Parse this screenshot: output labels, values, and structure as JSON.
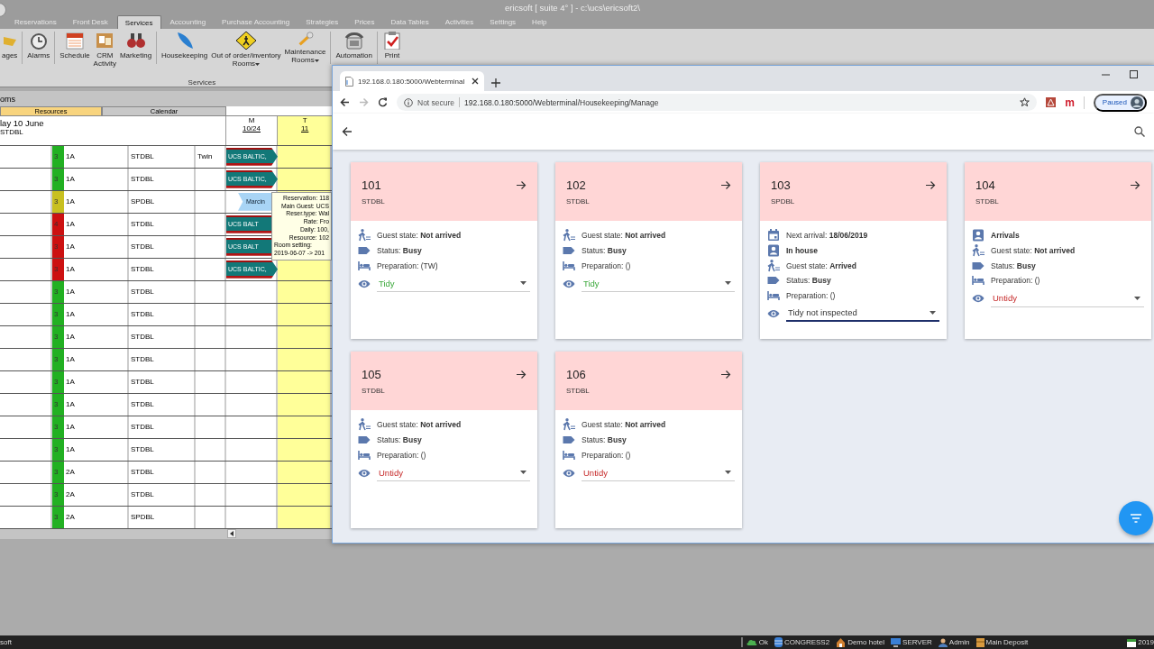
{
  "window": {
    "title": "ericsoft [ suite 4° ] - c:\\ucs\\ericsoft2\\"
  },
  "ribbon": {
    "tabs": [
      {
        "label": "Reservations",
        "selected": false
      },
      {
        "label": "Front Desk",
        "selected": false
      },
      {
        "label": "Services",
        "selected": true
      },
      {
        "label": "Accounting",
        "selected": false
      },
      {
        "label": "Purchase Accounting",
        "selected": false
      },
      {
        "label": "Strategies",
        "selected": false
      },
      {
        "label": "Prices",
        "selected": false
      },
      {
        "label": "Data Tables",
        "selected": false
      },
      {
        "label": "Activities",
        "selected": false
      },
      {
        "label": "Settings",
        "selected": false
      },
      {
        "label": "Help",
        "selected": false
      }
    ],
    "buttons": [
      {
        "lines": [
          "ages"
        ],
        "dropdown": false,
        "separator_after": true
      },
      {
        "lines": [
          "Alarms"
        ],
        "dropdown": false,
        "separator_after": true
      },
      {
        "lines": [
          "Schedule"
        ],
        "dropdown": false,
        "separator_after": false
      },
      {
        "lines": [
          "CRM",
          "Activity"
        ],
        "dropdown": false,
        "separator_after": false
      },
      {
        "lines": [
          "Marketing"
        ],
        "dropdown": false,
        "separator_after": true
      },
      {
        "lines": [
          "Housekeeping"
        ],
        "dropdown": false,
        "separator_after": false
      },
      {
        "lines": [
          "Out of order/inventory",
          "Rooms"
        ],
        "dropdown": true,
        "separator_after": false
      },
      {
        "lines": [
          "Maintenance",
          "Rooms"
        ],
        "dropdown": true,
        "separator_after": true
      },
      {
        "lines": [
          "Automation"
        ],
        "dropdown": false,
        "separator_after": true
      },
      {
        "lines": [
          "Print"
        ],
        "dropdown": false,
        "separator_after": false
      }
    ],
    "group_label": "Services"
  },
  "planner": {
    "title": "oms",
    "view_tabs": [
      {
        "label": "Resources",
        "selected": true
      },
      {
        "label": "Calendar",
        "selected": false
      }
    ],
    "header": {
      "date": "lay 10 June",
      "type": "STDBL"
    },
    "days": [
      {
        "weekday": "M",
        "date": "10/24",
        "highlight": false
      },
      {
        "weekday": "T",
        "date": "11",
        "highlight": true
      }
    ],
    "rows": [
      {
        "status": "3",
        "color": "#22b022",
        "floor": "1A",
        "type": "STDBL",
        "note": "Twin",
        "booking": {
          "text": "UCS BALTIC,",
          "kind": "group"
        }
      },
      {
        "status": "3",
        "color": "#22b022",
        "floor": "1A",
        "type": "STDBL",
        "booking": {
          "text": "UCS BALTIC,",
          "kind": "group"
        }
      },
      {
        "status": "3",
        "color": "#c8c020",
        "floor": "1A",
        "type": "SPDBL",
        "booking": {
          "text": "Marcin",
          "kind": "guest"
        }
      },
      {
        "status": "4",
        "color": "#cc1111",
        "floor": "1A",
        "type": "STDBL",
        "booking": {
          "text": "UCS BALT",
          "kind": "group"
        }
      },
      {
        "status": "3",
        "color": "#cc1111",
        "floor": "1A",
        "type": "STDBL",
        "booking": {
          "text": "UCS BALT",
          "kind": "group"
        }
      },
      {
        "status": "3",
        "color": "#cc1111",
        "floor": "1A",
        "type": "STDBL",
        "booking": {
          "text": "UCS BALTIC,",
          "kind": "group"
        }
      },
      {
        "status": "3",
        "color": "#22b022",
        "floor": "1A",
        "type": "STDBL"
      },
      {
        "status": "3",
        "color": "#22b022",
        "floor": "1A",
        "type": "STDBL"
      },
      {
        "status": "3",
        "color": "#22b022",
        "floor": "1A",
        "type": "STDBL"
      },
      {
        "status": "3",
        "color": "#22b022",
        "floor": "1A",
        "type": "STDBL"
      },
      {
        "status": "3",
        "color": "#22b022",
        "floor": "1A",
        "type": "STDBL"
      },
      {
        "status": "3",
        "color": "#22b022",
        "floor": "1A",
        "type": "STDBL"
      },
      {
        "status": "3",
        "color": "#22b022",
        "floor": "1A",
        "type": "STDBL"
      },
      {
        "status": "3",
        "color": "#22b022",
        "floor": "1A",
        "type": "STDBL"
      },
      {
        "status": "3",
        "color": "#22b022",
        "floor": "2A",
        "type": "STDBL"
      },
      {
        "status": "3",
        "color": "#22b022",
        "floor": "2A",
        "type": "STDBL"
      },
      {
        "status": "3",
        "color": "#22b022",
        "floor": "2A",
        "type": "SPDBL"
      }
    ],
    "tooltip": [
      "Reservation: 118",
      "Main Guest: UCS",
      "Reser.type: Wal",
      "Rate: Fro",
      "Daily: 100,",
      "Resource: 102",
      "Room setting:",
      "2019-06-07 -> 201"
    ]
  },
  "browser": {
    "tab_title": "192.168.0.180:5000/Webterminal",
    "security": "Not secure",
    "url": "192.168.0.180:5000/Webterminal/Housekeeping/Manage",
    "extension_letter": "m",
    "profile": "Paused"
  },
  "rooms": [
    {
      "number": "101",
      "type": "STDBL",
      "lines": [
        {
          "kind": "guest_state",
          "label": "Guest state:",
          "value": "Not arrived"
        },
        {
          "kind": "status",
          "label": "Status:",
          "value": "Busy"
        },
        {
          "kind": "preparation",
          "label": "Preparation: (TW)"
        }
      ],
      "cleaning": {
        "value": "Tidy",
        "clean": true,
        "inspected": true,
        "focused": false
      }
    },
    {
      "number": "102",
      "type": "STDBL",
      "lines": [
        {
          "kind": "guest_state",
          "label": "Guest state:",
          "value": "Not arrived"
        },
        {
          "kind": "status",
          "label": "Status:",
          "value": "Busy"
        },
        {
          "kind": "preparation",
          "label": "Preparation: ()"
        }
      ],
      "cleaning": {
        "value": "Tidy",
        "clean": true,
        "inspected": true,
        "focused": false
      }
    },
    {
      "number": "103",
      "type": "SPDBL",
      "lines": [
        {
          "kind": "next_arrival",
          "label": "Next arrival:",
          "value": "18/06/2019"
        },
        {
          "kind": "in_house",
          "value": "In house"
        },
        {
          "kind": "guest_state",
          "label": "Guest state:",
          "value": "Arrived"
        },
        {
          "kind": "status",
          "label": "Status:",
          "value": "Busy"
        },
        {
          "kind": "preparation",
          "label": "Preparation: ()"
        }
      ],
      "cleaning": {
        "value": "Tidy not inspected",
        "clean": true,
        "inspected": false,
        "focused": true
      }
    },
    {
      "number": "104",
      "type": "STDBL",
      "lines": [
        {
          "kind": "arrivals",
          "value": "Arrivals"
        },
        {
          "kind": "guest_state",
          "label": "Guest state:",
          "value": "Not arrived"
        },
        {
          "kind": "status",
          "label": "Status:",
          "value": "Busy"
        },
        {
          "kind": "preparation",
          "label": "Preparation: ()"
        }
      ],
      "cleaning": {
        "value": "Untidy",
        "clean": false,
        "inspected": true,
        "focused": false
      }
    },
    {
      "number": "105",
      "type": "STDBL",
      "lines": [
        {
          "kind": "guest_state",
          "label": "Guest state:",
          "value": "Not arrived"
        },
        {
          "kind": "status",
          "label": "Status:",
          "value": "Busy"
        },
        {
          "kind": "preparation",
          "label": "Preparation: ()"
        }
      ],
      "cleaning": {
        "value": "Untidy",
        "clean": false,
        "inspected": true,
        "focused": false
      }
    },
    {
      "number": "106",
      "type": "STDBL",
      "lines": [
        {
          "kind": "guest_state",
          "label": "Guest state:",
          "value": "Not arrived"
        },
        {
          "kind": "status",
          "label": "Status:",
          "value": "Busy"
        },
        {
          "kind": "preparation",
          "label": "Preparation: ()"
        }
      ],
      "cleaning": {
        "value": "Untidy",
        "clean": false,
        "inspected": true,
        "focused": false
      }
    }
  ],
  "taskbar": {
    "app": "soft",
    "items": [
      "Ok",
      "CONGRESS2",
      "Demo hotel",
      "SERVER",
      "Admin",
      "Main Deposit"
    ],
    "date": "2019"
  }
}
